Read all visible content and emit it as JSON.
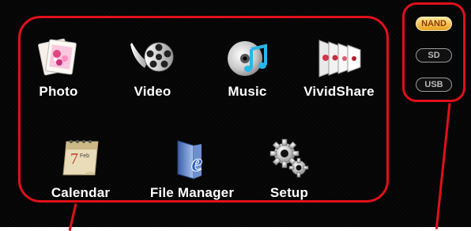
{
  "apps": [
    {
      "label": "Photo",
      "icon": "photo-icon"
    },
    {
      "label": "Video",
      "icon": "video-icon"
    },
    {
      "label": "Music",
      "icon": "music-icon"
    },
    {
      "label": "VividShare",
      "icon": "vividshare-icon"
    },
    {
      "label": "Calendar",
      "icon": "calendar-icon"
    },
    {
      "label": "File Manager",
      "icon": "file-manager-icon"
    },
    {
      "label": "Setup",
      "icon": "setup-icon"
    }
  ],
  "calendar_icon_text": "7",
  "calendar_icon_month": "Feb",
  "storage": {
    "selected": "NAND",
    "options": [
      "NAND",
      "SD",
      "USB"
    ]
  },
  "colors": {
    "highlight_outline": "#e0101a",
    "screen_background": "#050505",
    "selected_pill": "#f0b93a"
  }
}
